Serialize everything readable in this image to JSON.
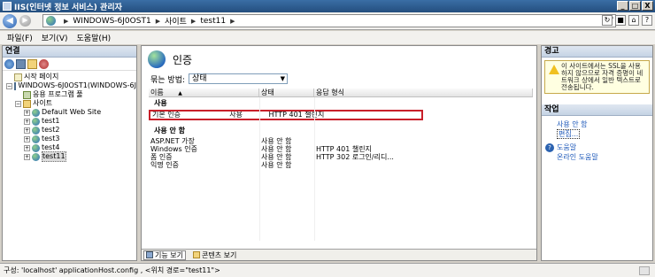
{
  "window": {
    "title": "IIS(인터넷 정보 서비스) 관리자",
    "minimize": "_",
    "maximize": "□",
    "close": "X"
  },
  "address": {
    "crumbs": [
      "WINDOWS-6J0OST1",
      "사이트",
      "test11"
    ],
    "sep": "▶"
  },
  "menu": {
    "items": [
      "파일(F)",
      "보기(V)",
      "도움말(H)"
    ]
  },
  "connections": {
    "header": "연결",
    "tree": [
      {
        "label": "시작 페이지",
        "icon": "page-icon",
        "indent": 0,
        "expander": ""
      },
      {
        "label": "WINDOWS-6J0OST1(WINDOWS-6J",
        "icon": "server-icon",
        "indent": 0,
        "expander": "−"
      },
      {
        "label": "응용 프로그램 풀",
        "icon": "app-pool-icon",
        "indent": 1,
        "expander": ""
      },
      {
        "label": "사이트",
        "icon": "folder-icon",
        "indent": 1,
        "expander": "−"
      },
      {
        "label": "Default Web Site",
        "icon": "globe-icon",
        "indent": 2,
        "expander": "+"
      },
      {
        "label": "test1",
        "icon": "globe-icon",
        "indent": 2,
        "expander": "+"
      },
      {
        "label": "test2",
        "icon": "globe-icon",
        "indent": 2,
        "expander": "+"
      },
      {
        "label": "test3",
        "icon": "globe-icon",
        "indent": 2,
        "expander": "+"
      },
      {
        "label": "test4",
        "icon": "globe-icon",
        "indent": 2,
        "expander": "+"
      },
      {
        "label": "test11",
        "icon": "globe-icon",
        "indent": 2,
        "expander": "+",
        "selected": true
      }
    ]
  },
  "main": {
    "title": "인증",
    "group_label": "묶는 방법:",
    "group_value": "상태",
    "columns": [
      "이름",
      "상태",
      "응답 형식"
    ],
    "sort_indicator": "▲",
    "section_enabled": "사용",
    "enabled_rows": [
      {
        "name": "기본 인증",
        "status": "사용",
        "response": "HTTP 401 챌린지"
      }
    ],
    "section_disabled": "사용 안 함",
    "disabled_rows": [
      {
        "name": "ASP.NET 가장",
        "status": "사용 안 함",
        "response": ""
      },
      {
        "name": "Windows 인증",
        "status": "사용 안 함",
        "response": "HTTP 401 챌린지"
      },
      {
        "name": "폼 인증",
        "status": "사용 안 함",
        "response": "HTTP 302 로그인/리디..."
      },
      {
        "name": "익명 인증",
        "status": "사용 안 함",
        "response": ""
      }
    ],
    "tabs": [
      "기능 보기",
      "콘텐츠 보기"
    ]
  },
  "actions": {
    "alert_header": "경고",
    "alert_text": "이 사이트에서는 SSL을 사용하지 않으므로 자격 증명이 네트워크 상에서 일반 텍스트로 전송됩니다.",
    "header": "작업",
    "links": [
      "사용 안 함",
      "편집..."
    ],
    "help": [
      "도움말",
      "온라인 도움말"
    ]
  },
  "status": {
    "text": "구성: 'localhost' applicationHost.config , <위치 경로=\"test11\">"
  },
  "colors": {
    "highlight_border": "#c8202a",
    "link": "#1a56b8",
    "alert_bg": "#ffffe1"
  }
}
